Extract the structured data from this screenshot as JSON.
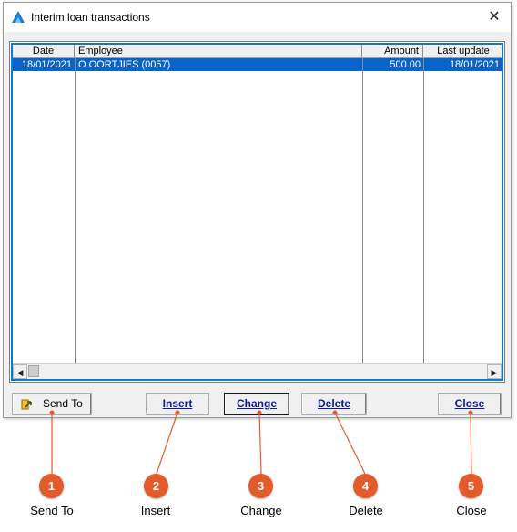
{
  "window": {
    "title": "Interim loan transactions",
    "close_glyph": "✕"
  },
  "grid": {
    "columns": [
      "Date",
      "Employee",
      "Amount",
      "Last update"
    ],
    "rows": [
      {
        "date": "18/01/2021",
        "employee": "O OORTJIES (0057)",
        "amount": "500.00",
        "last_update": "18/01/2021"
      }
    ]
  },
  "buttons": {
    "send_to": "Send To",
    "insert": "Insert",
    "change": "Change",
    "delete": "Delete",
    "close": "Close"
  },
  "callouts": [
    {
      "number": "1",
      "label": "Send To"
    },
    {
      "number": "2",
      "label": "Insert"
    },
    {
      "number": "3",
      "label": "Change"
    },
    {
      "number": "4",
      "label": "Delete"
    },
    {
      "number": "5",
      "label": "Close"
    }
  ],
  "colors": {
    "selection": "#0a64c8",
    "badge": "#e35b2a",
    "accent_border": "#0b7ad2"
  },
  "icons": {
    "app": "blue-triangle-logo-icon",
    "send_to": "send-arrow-icon"
  }
}
